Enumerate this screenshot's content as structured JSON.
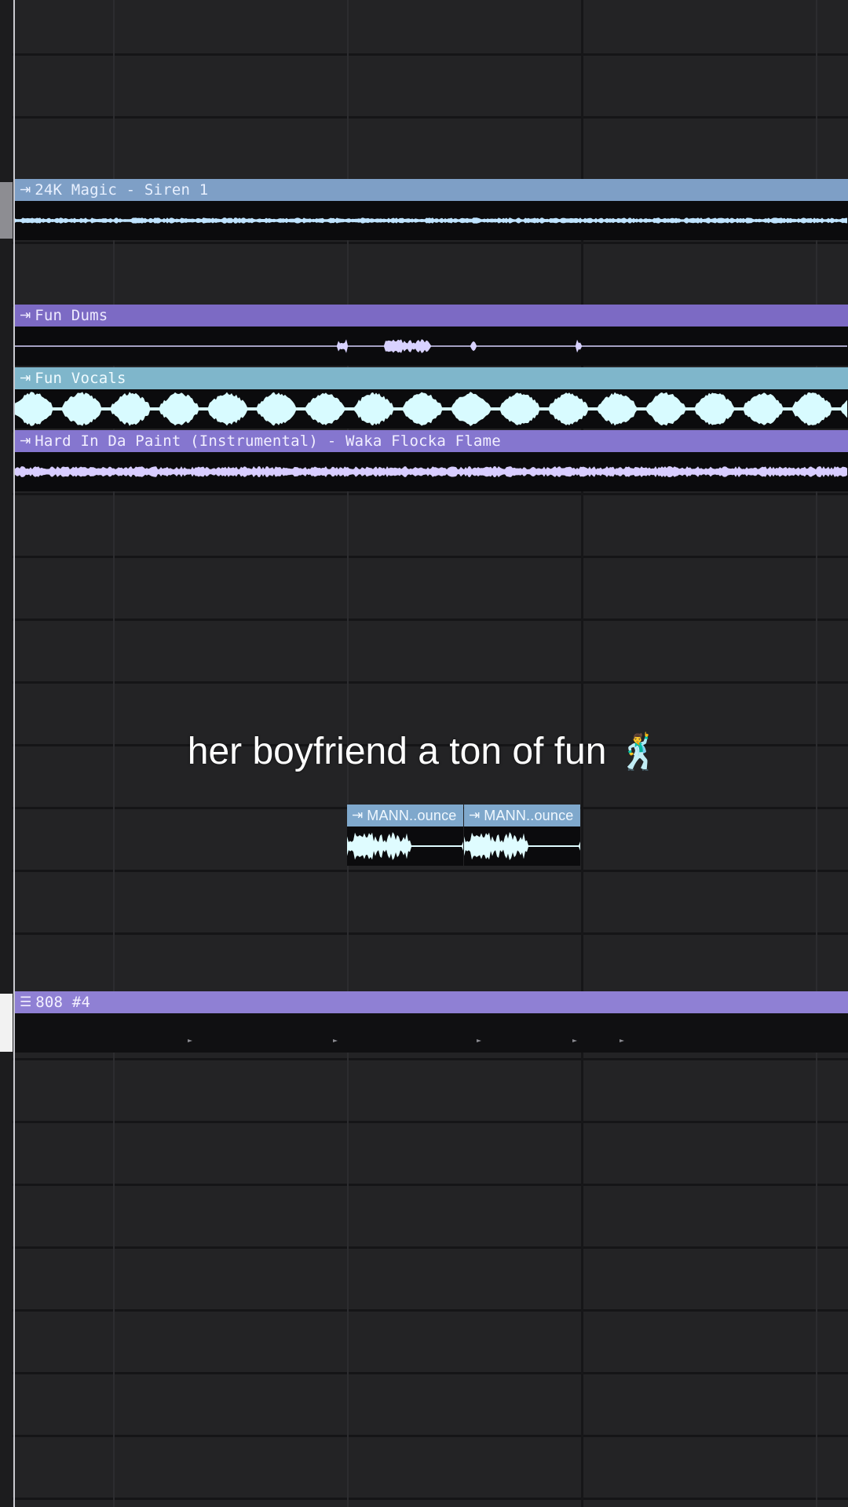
{
  "playlist": {
    "clips": [
      {
        "id": "siren",
        "title": "24K Magic - Siren 1",
        "kind": "audio",
        "header_color": "#7e9fc6",
        "title_color": "#e8f0ff",
        "wave_color": "#bfe3ff"
      },
      {
        "id": "drums",
        "title": "Fun Dums",
        "kind": "audio",
        "header_color": "#7c6ac4",
        "title_color": "#eeeaff",
        "wave_color": "#d8d2ff"
      },
      {
        "id": "vocals",
        "title": "Fun Vocals",
        "kind": "audio",
        "header_color": "#7fb6cb",
        "title_color": "#f0fbff",
        "wave_color": "#d8fbff"
      },
      {
        "id": "instrumental",
        "title": "Hard In Da Paint (Instrumental) - Waka Flocka Flame",
        "kind": "audio",
        "header_color": "#8576cf",
        "title_color": "#f1eeff",
        "wave_color": "#d8cdff"
      },
      {
        "id": "mann1",
        "title": "MANN..ounce",
        "kind": "audio",
        "header_color": "#7fa8cc",
        "title_color": "#f0f8ff",
        "wave_color": "#dffcff"
      },
      {
        "id": "mann2",
        "title": "MANN..ounce",
        "kind": "audio",
        "header_color": "#7fa8cc",
        "title_color": "#f0f8ff",
        "wave_color": "#dffcff"
      },
      {
        "id": "808",
        "title": "808 #4",
        "kind": "pattern",
        "header_color": "#8f80d4",
        "title_color": "#f3f0ff",
        "wave_color": "#8a8a90"
      }
    ]
  },
  "caption": {
    "text": "her boyfriend a ton of fun",
    "emoji": "🕺"
  }
}
